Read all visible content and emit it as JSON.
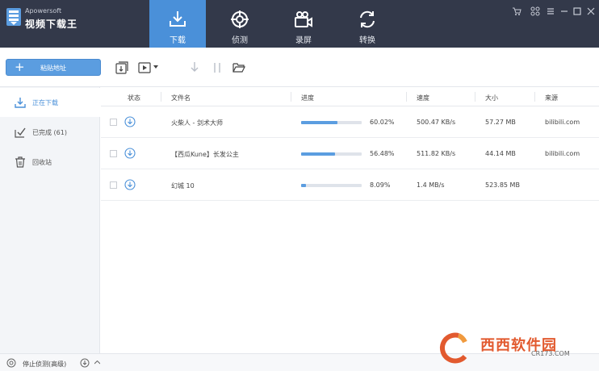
{
  "app": {
    "brand_small": "Apowersoft",
    "brand_main": "视频下载王"
  },
  "nav": {
    "tabs": [
      {
        "label": "下载",
        "icon": "download-tray-icon",
        "active": true
      },
      {
        "label": "侦测",
        "icon": "target-icon",
        "active": false
      },
      {
        "label": "录屏",
        "icon": "camera-icon",
        "active": false
      },
      {
        "label": "转换",
        "icon": "convert-icon",
        "active": false
      }
    ]
  },
  "toolbar": {
    "paste_label": "粘贴地址"
  },
  "sidebar": {
    "items": [
      {
        "label": "正在下载",
        "active": true
      },
      {
        "label": "已完成 (61)",
        "active": false
      },
      {
        "label": "回收站",
        "active": false
      }
    ]
  },
  "table": {
    "columns": [
      "状态",
      "文件名",
      "进度",
      "速度",
      "大小",
      "来源"
    ],
    "rows": [
      {
        "name": "火柴人 - 剑术大师",
        "progress_text": "60.02%",
        "progress": 0.6002,
        "speed": "500.47 KB/s",
        "size": "57.27 MB",
        "source": "bilibili.com"
      },
      {
        "name": "【西瓜Kune】长发公主",
        "progress_text": "56.48%",
        "progress": 0.5648,
        "speed": "511.82 KB/s",
        "size": "44.14 MB",
        "source": "bilibili.com"
      },
      {
        "name": "幻城 10",
        "progress_text": "8.09%",
        "progress": 0.0809,
        "speed": "1.4 MB/s",
        "size": "523.85 MB",
        "source": ""
      }
    ]
  },
  "statusbar": {
    "stop_label": "停止侦测(高级)"
  },
  "watermark": {
    "text": "西西软件园",
    "sub": "CR173.COM"
  },
  "colors": {
    "titlebar": "#33394a",
    "accent": "#4a90d9",
    "progress": "#5b9de0"
  }
}
